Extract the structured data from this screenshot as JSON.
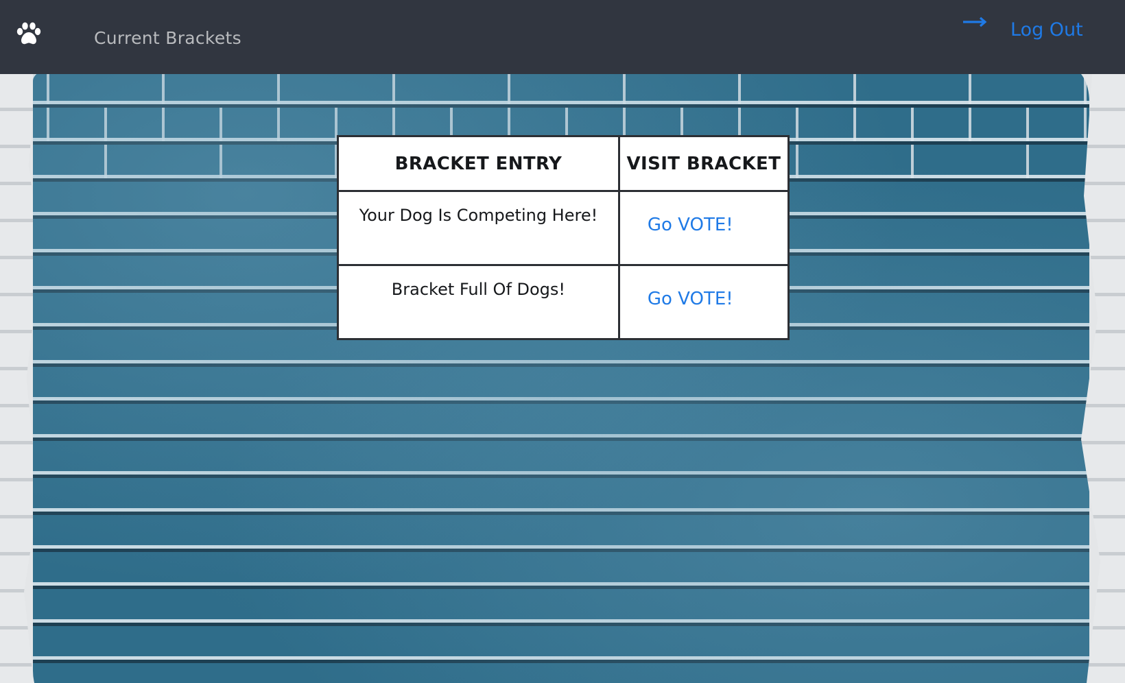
{
  "nav": {
    "title": "Current Brackets",
    "logout_label": "Log Out",
    "accent_color": "#1f7ae6",
    "bar_color": "#313640",
    "logo_icon": "paw-icon",
    "logout_icon": "arrow-right-icon"
  },
  "table": {
    "headers": [
      "BRACKET ENTRY",
      "VISIT BRACKET"
    ],
    "rows": [
      {
        "entry": "Your Dog Is Competing Here!",
        "link": "Go VOTE!"
      },
      {
        "entry": "Bracket Full Of Dogs!",
        "link": "Go VOTE!"
      }
    ]
  }
}
